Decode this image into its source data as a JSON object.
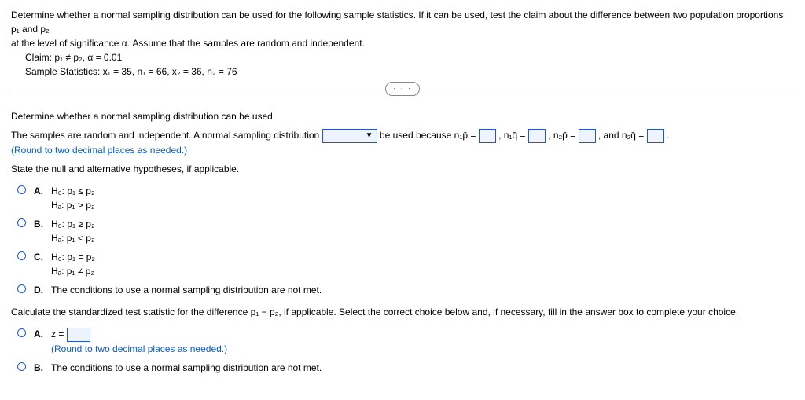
{
  "intro": {
    "line1": "Determine whether a normal sampling distribution can be used for the following sample statistics. If it can be used, test the claim about the difference between two population proportions p₁ and p₂",
    "line2": "at the level of significance α. Assume that the samples are random and independent.",
    "claim": "Claim: p₁ ≠ p₂, α = 0.01",
    "stats": "Sample Statistics: x₁ = 35, n₁ = 66, x₂ = 36, n₂ = 76"
  },
  "tab_dots": "· · ·",
  "prompt1": "Determine whether a normal sampling distribution can be used.",
  "fill": {
    "pre": "The samples are random and independent. A normal sampling distribution ",
    "post": " be used because n₁p̄ = ",
    "sep1": ", n₁q̄ = ",
    "sep2": ", n₂p̄ = ",
    "sep3": ", and n₂q̄ = ",
    "end": "."
  },
  "round_hint1": "(Round to two decimal places as needed.)",
  "prompt2": "State the null and alternative hypotheses, if applicable.",
  "options": {
    "A": {
      "l1": "H₀: p₁ ≤ p₂",
      "l2": "Hₐ: p₁ > p₂"
    },
    "B": {
      "l1": "H₀: p₁ ≥ p₂",
      "l2": "Hₐ: p₁ < p₂"
    },
    "C": {
      "l1": "H₀: p₁ = p₂",
      "l2": "Hₐ: p₁ ≠ p₂"
    },
    "D": {
      "text": "The conditions to use a normal sampling distribution are not met."
    }
  },
  "calc_prompt": "Calculate the standardized test statistic for the difference p₁ − p₂, if applicable. Select the correct choice below and, if necessary, fill in the answer box to complete your choice.",
  "z_label": "z = ",
  "round_hint2": "(Round to two decimal places as needed.)",
  "optB2": "The conditions to use a normal sampling distribution are not met.",
  "labels": {
    "A": "A.",
    "B": "B.",
    "C": "C.",
    "D": "D."
  },
  "dropdown_arrow": "▼"
}
